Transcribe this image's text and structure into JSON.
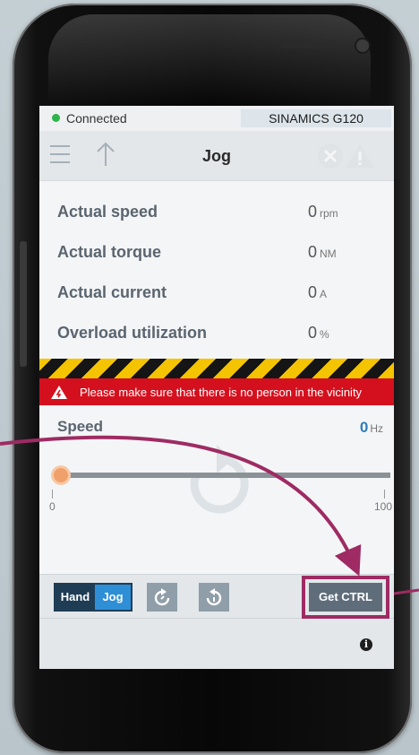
{
  "status": {
    "connection": "Connected",
    "device": "SINAMICS G120"
  },
  "appbar": {
    "title": "Jog"
  },
  "readings": [
    {
      "label": "Actual speed",
      "value": "0",
      "unit": "rpm"
    },
    {
      "label": "Actual torque",
      "value": "0",
      "unit": "NM"
    },
    {
      "label": "Actual current",
      "value": "0",
      "unit": "A"
    },
    {
      "label": "Overload utilization",
      "value": "0",
      "unit": "%"
    }
  ],
  "warning": {
    "text": "Please make sure that there is no person in the vicinity"
  },
  "speed": {
    "label": "Speed",
    "value": "0",
    "unit": "Hz",
    "min": "0",
    "max": "100",
    "level": 0
  },
  "controls": {
    "hand_label": "Hand",
    "jog_label": "Jog",
    "get_ctrl_label": "Get CTRL"
  },
  "icons": [
    "menu-icon",
    "up-arrow-icon",
    "fault-icon",
    "alarm-icon",
    "warning-triangle-icon",
    "rotate-clockwise-icon",
    "rotate-counterclockwise-icon",
    "info-icon"
  ],
  "colors": {
    "accent": "#2e8fd6",
    "warning": "#d5101e",
    "connected": "#2db54a",
    "callout": "#9e2b63",
    "slider_thumb": "#f0a06a"
  }
}
